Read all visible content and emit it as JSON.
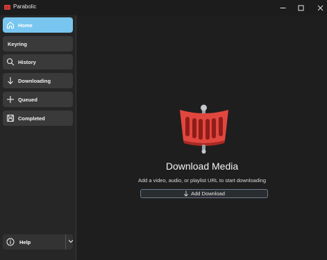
{
  "window": {
    "title": "Parabolic",
    "controls": {
      "minimize": "—",
      "maximize": "☐",
      "close": "✕"
    }
  },
  "sidebar": {
    "items": [
      {
        "label": "Home",
        "icon": "home-icon",
        "active": true
      },
      {
        "label": "Keyring",
        "icon": "",
        "active": false
      },
      {
        "label": "History",
        "icon": "search-icon",
        "active": false
      },
      {
        "label": "Downloading",
        "icon": "download-arrow-icon",
        "active": false
      },
      {
        "label": "Queued",
        "icon": "plus-icon",
        "active": false
      },
      {
        "label": "Completed",
        "icon": "save-icon",
        "active": false
      }
    ],
    "help": {
      "label": "Help",
      "icon": "info-icon"
    }
  },
  "main": {
    "hero_icon": "parabolic-logo",
    "title": "Download Media",
    "subtitle": "Add a video, audio, or playlist URL to start downloading",
    "add_button_label": "Add Download"
  },
  "colors": {
    "accent": "#78c6ef",
    "brand_red": "#e2473f",
    "background": "#1e1e1e",
    "sidebar": "#262626"
  }
}
